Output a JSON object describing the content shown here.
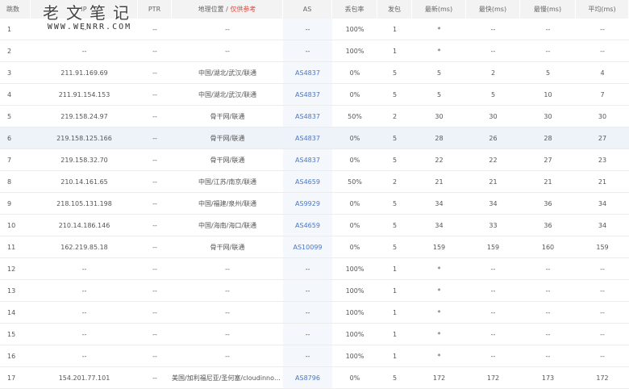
{
  "headers": [
    "跳数",
    "IP",
    "PTR",
    "地理位置 /",
    "仅供参考",
    "AS",
    "丢包率",
    "发包",
    "最新(ms)",
    "最快(ms)",
    "最慢(ms)",
    "平均(ms)"
  ],
  "watermark": {
    "title": "老文笔记",
    "url": "WWW.WENRR.COM"
  },
  "rows": [
    [
      "1",
      "--",
      "--",
      "--",
      "--",
      "100%",
      "1",
      "*",
      "--",
      "--",
      "--"
    ],
    [
      "2",
      "--",
      "--",
      "--",
      "--",
      "100%",
      "1",
      "*",
      "--",
      "--",
      "--"
    ],
    [
      "3",
      "211.91.169.69",
      "--",
      "中国/湖北/武汉/联通",
      "AS4837",
      "0%",
      "5",
      "5",
      "2",
      "5",
      "4"
    ],
    [
      "4",
      "211.91.154.153",
      "--",
      "中国/湖北/武汉/联通",
      "AS4837",
      "0%",
      "5",
      "5",
      "5",
      "10",
      "7"
    ],
    [
      "5",
      "219.158.24.97",
      "--",
      "骨干网/联通",
      "AS4837",
      "50%",
      "2",
      "30",
      "30",
      "30",
      "30"
    ],
    [
      "6",
      "219.158.125.166",
      "--",
      "骨干网/联通",
      "AS4837",
      "0%",
      "5",
      "28",
      "26",
      "28",
      "27"
    ],
    [
      "7",
      "219.158.32.70",
      "--",
      "骨干网/联通",
      "AS4837",
      "0%",
      "5",
      "22",
      "22",
      "27",
      "23"
    ],
    [
      "8",
      "210.14.161.65",
      "--",
      "中国/江苏/南京/联通",
      "AS4659",
      "50%",
      "2",
      "21",
      "21",
      "21",
      "21"
    ],
    [
      "9",
      "218.105.131.198",
      "--",
      "中国/福建/泉州/联通",
      "AS9929",
      "0%",
      "5",
      "34",
      "34",
      "36",
      "34"
    ],
    [
      "10",
      "210.14.186.146",
      "--",
      "中国/海南/海口/联通",
      "AS4659",
      "0%",
      "5",
      "34",
      "33",
      "36",
      "34"
    ],
    [
      "11",
      "162.219.85.18",
      "--",
      "骨干网/联通",
      "AS10099",
      "0%",
      "5",
      "159",
      "159",
      "160",
      "159"
    ],
    [
      "12",
      "--",
      "--",
      "--",
      "--",
      "100%",
      "1",
      "*",
      "--",
      "--",
      "--"
    ],
    [
      "13",
      "--",
      "--",
      "--",
      "--",
      "100%",
      "1",
      "*",
      "--",
      "--",
      "--"
    ],
    [
      "14",
      "--",
      "--",
      "--",
      "--",
      "100%",
      "1",
      "*",
      "--",
      "--",
      "--"
    ],
    [
      "15",
      "--",
      "--",
      "--",
      "--",
      "100%",
      "1",
      "*",
      "--",
      "--",
      "--"
    ],
    [
      "16",
      "--",
      "--",
      "--",
      "--",
      "100%",
      "1",
      "*",
      "--",
      "--",
      "--"
    ],
    [
      "17",
      "154.201.77.101",
      "--",
      "美国/加利福尼亚/圣何塞/cloudinnovation.org",
      "AS8796",
      "0%",
      "5",
      "172",
      "172",
      "173",
      "172"
    ]
  ]
}
